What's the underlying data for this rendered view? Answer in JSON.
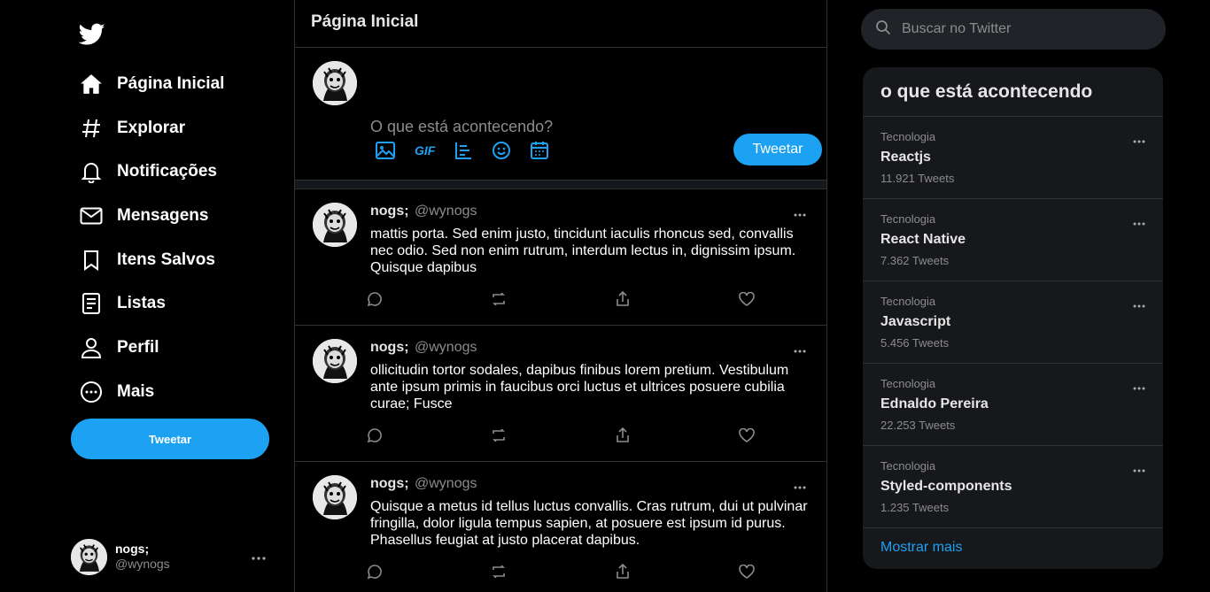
{
  "sidebar": {
    "nav": [
      {
        "label": "Página Inicial",
        "icon": "home-icon"
      },
      {
        "label": "Explorar",
        "icon": "hashtag-icon"
      },
      {
        "label": "Notificações",
        "icon": "bell-icon"
      },
      {
        "label": "Mensagens",
        "icon": "mail-icon"
      },
      {
        "label": "Itens Salvos",
        "icon": "bookmark-icon"
      },
      {
        "label": "Listas",
        "icon": "list-icon"
      },
      {
        "label": "Perfil",
        "icon": "person-icon"
      },
      {
        "label": "Mais",
        "icon": "more-circle-icon"
      }
    ],
    "tweet_button": "Tweetar",
    "profile": {
      "name": "nogs;",
      "handle": "@wynogs"
    }
  },
  "main": {
    "title": "Página Inicial",
    "composer": {
      "placeholder": "O que está acontecendo?",
      "gif_label": "GIF",
      "tweet_button": "Tweetar"
    },
    "tweets": [
      {
        "author": "nogs;",
        "handle": "@wynogs",
        "text": "mattis porta. Sed enim justo, tincidunt iaculis rhoncus sed, convallis nec odio. Sed non enim rutrum, interdum lectus in, dignissim ipsum. Quisque dapibus"
      },
      {
        "author": "nogs;",
        "handle": "@wynogs",
        "text": "ollicitudin tortor sodales, dapibus finibus lorem pretium. Vestibulum ante ipsum primis in faucibus orci luctus et ultrices posuere cubilia curae; Fusce"
      },
      {
        "author": "nogs;",
        "handle": "@wynogs",
        "text": "Quisque a metus id tellus luctus convallis. Cras rutrum, dui ut pulvinar fringilla, dolor ligula tempus sapien, at posuere est ipsum id purus. Phasellus feugiat at justo placerat dapibus."
      }
    ]
  },
  "right": {
    "search_placeholder": "Buscar no Twitter",
    "trends_title": "o que está acontecendo",
    "trends": [
      {
        "category": "Tecnologia",
        "name": "Reactjs",
        "count": "11.921 Tweets"
      },
      {
        "category": "Tecnologia",
        "name": "React Native",
        "count": "7.362 Tweets"
      },
      {
        "category": "Tecnologia",
        "name": "Javascript",
        "count": "5.456 Tweets"
      },
      {
        "category": "Tecnologia",
        "name": "Ednaldo Pereira",
        "count": "22.253 Tweets"
      },
      {
        "category": "Tecnologia",
        "name": "Styled-components",
        "count": "1.235 Tweets"
      }
    ],
    "show_more": "Mostrar mais"
  },
  "colors": {
    "accent": "#1da1f2",
    "background": "#000000",
    "panel": "#16181c",
    "border": "#2f3336",
    "muted": "#8c8c8c"
  }
}
